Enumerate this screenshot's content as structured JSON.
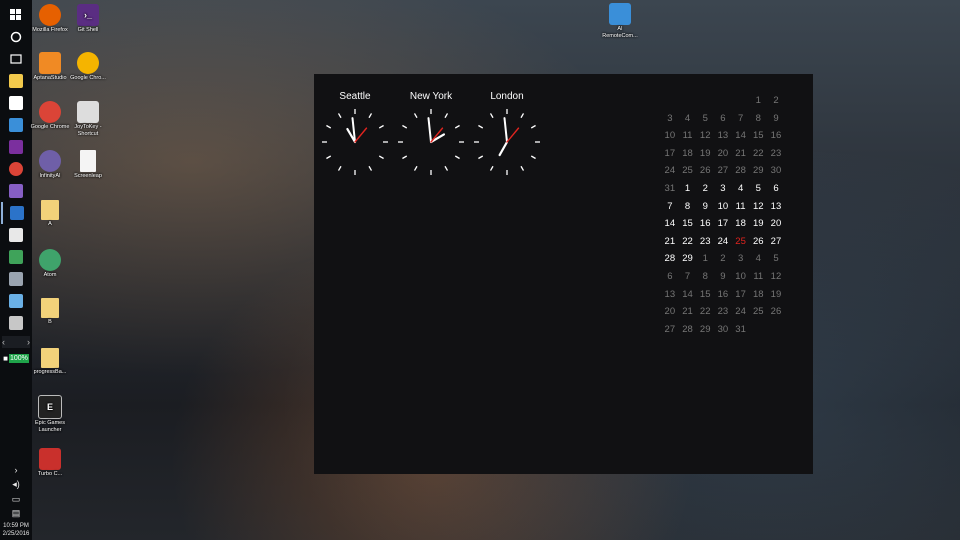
{
  "taskbar": {
    "battery_label": "100%",
    "time": "10:59 PM",
    "date": "2/25/2016"
  },
  "desktop_icons": [
    {
      "label": "Mozilla Firefox",
      "icon": "firefox-icon",
      "color": "#e66000"
    },
    {
      "label": "Git Shell",
      "icon": "git-shell-icon",
      "color": "#5a2d82"
    },
    {
      "label": "AptanaStudio",
      "icon": "aptana-icon",
      "color": "#f08a24"
    },
    {
      "label": "Google Chro...",
      "icon": "chrome-canary-icon",
      "color": "#f5b400"
    },
    {
      "label": "Google Chrome",
      "icon": "chrome-icon",
      "color": "#db4437"
    },
    {
      "label": "JoyToKey - Shortcut",
      "icon": "joytokey-icon",
      "color": "#dddddd"
    },
    {
      "label": "InfinityAI",
      "icon": "infinity-icon",
      "color": "#6f5fa8"
    },
    {
      "label": "Screenleap",
      "icon": "document-icon",
      "color": "#f4f4f4"
    },
    {
      "label": "A",
      "icon": "folder-icon",
      "color": "#f2d27a"
    },
    {
      "label": "Atom",
      "icon": "atom-icon",
      "color": "#3fa36b"
    },
    {
      "label": "B",
      "icon": "folder-icon",
      "color": "#f2d27a"
    },
    {
      "label": "progressBa...",
      "icon": "folder-icon",
      "color": "#f2d27a"
    },
    {
      "label": "Epic Games Launcher",
      "icon": "epic-games-icon",
      "color": "#222222"
    },
    {
      "label": "Turbo C...",
      "icon": "turbo-c-icon",
      "color": "#c9302c"
    },
    {
      "label": "AI RemoteCom...",
      "icon": "network-computer-icon",
      "color": "#3a8fd9"
    }
  ],
  "clocks": [
    {
      "city": "Seattle",
      "hour": 10,
      "minute": 59
    },
    {
      "city": "New York",
      "hour": 1,
      "minute": 59
    },
    {
      "city": "London",
      "hour": 6,
      "minute": 59
    }
  ],
  "calendar": {
    "rows": [
      [
        {
          "d": "",
          "c": 0
        },
        {
          "d": "",
          "c": 0
        },
        {
          "d": "",
          "c": 0
        },
        {
          "d": "",
          "c": 0
        },
        {
          "d": "",
          "c": 0
        },
        {
          "d": "1",
          "c": 0
        },
        {
          "d": "2",
          "c": 0
        }
      ],
      [
        {
          "d": "3",
          "c": 0
        },
        {
          "d": "4",
          "c": 0
        },
        {
          "d": "5",
          "c": 0
        },
        {
          "d": "6",
          "c": 0
        },
        {
          "d": "7",
          "c": 0
        },
        {
          "d": "8",
          "c": 0
        },
        {
          "d": "9",
          "c": 0
        }
      ],
      [
        {
          "d": "10",
          "c": 0
        },
        {
          "d": "11",
          "c": 0
        },
        {
          "d": "12",
          "c": 0
        },
        {
          "d": "13",
          "c": 0
        },
        {
          "d": "14",
          "c": 0
        },
        {
          "d": "15",
          "c": 0
        },
        {
          "d": "16",
          "c": 0
        }
      ],
      [
        {
          "d": "17",
          "c": 0
        },
        {
          "d": "18",
          "c": 0
        },
        {
          "d": "19",
          "c": 0
        },
        {
          "d": "20",
          "c": 0
        },
        {
          "d": "21",
          "c": 0
        },
        {
          "d": "22",
          "c": 0
        },
        {
          "d": "23",
          "c": 0
        }
      ],
      [
        {
          "d": "24",
          "c": 0
        },
        {
          "d": "25",
          "c": 0
        },
        {
          "d": "26",
          "c": 0
        },
        {
          "d": "27",
          "c": 0
        },
        {
          "d": "28",
          "c": 0
        },
        {
          "d": "29",
          "c": 0
        },
        {
          "d": "30",
          "c": 0
        }
      ],
      [
        {
          "d": "31",
          "c": 0
        },
        {
          "d": "1",
          "c": 1
        },
        {
          "d": "2",
          "c": 1
        },
        {
          "d": "3",
          "c": 1
        },
        {
          "d": "4",
          "c": 1
        },
        {
          "d": "5",
          "c": 1
        },
        {
          "d": "6",
          "c": 1
        }
      ],
      [
        {
          "d": "7",
          "c": 1
        },
        {
          "d": "8",
          "c": 1
        },
        {
          "d": "9",
          "c": 1
        },
        {
          "d": "10",
          "c": 1
        },
        {
          "d": "11",
          "c": 1
        },
        {
          "d": "12",
          "c": 1
        },
        {
          "d": "13",
          "c": 1
        }
      ],
      [
        {
          "d": "14",
          "c": 1
        },
        {
          "d": "15",
          "c": 1
        },
        {
          "d": "16",
          "c": 1
        },
        {
          "d": "17",
          "c": 1
        },
        {
          "d": "18",
          "c": 1
        },
        {
          "d": "19",
          "c": 1
        },
        {
          "d": "20",
          "c": 1
        }
      ],
      [
        {
          "d": "21",
          "c": 1
        },
        {
          "d": "22",
          "c": 1
        },
        {
          "d": "23",
          "c": 1
        },
        {
          "d": "24",
          "c": 1
        },
        {
          "d": "25",
          "c": 2
        },
        {
          "d": "26",
          "c": 1
        },
        {
          "d": "27",
          "c": 1
        }
      ],
      [
        {
          "d": "28",
          "c": 1
        },
        {
          "d": "29",
          "c": 1
        },
        {
          "d": "1",
          "c": 0
        },
        {
          "d": "2",
          "c": 0
        },
        {
          "d": "3",
          "c": 0
        },
        {
          "d": "4",
          "c": 0
        },
        {
          "d": "5",
          "c": 0
        }
      ],
      [
        {
          "d": "6",
          "c": 0
        },
        {
          "d": "7",
          "c": 0
        },
        {
          "d": "8",
          "c": 0
        },
        {
          "d": "9",
          "c": 0
        },
        {
          "d": "10",
          "c": 0
        },
        {
          "d": "11",
          "c": 0
        },
        {
          "d": "12",
          "c": 0
        }
      ],
      [
        {
          "d": "13",
          "c": 0
        },
        {
          "d": "14",
          "c": 0
        },
        {
          "d": "15",
          "c": 0
        },
        {
          "d": "16",
          "c": 0
        },
        {
          "d": "17",
          "c": 0
        },
        {
          "d": "18",
          "c": 0
        },
        {
          "d": "19",
          "c": 0
        }
      ],
      [
        {
          "d": "20",
          "c": 0
        },
        {
          "d": "21",
          "c": 0
        },
        {
          "d": "22",
          "c": 0
        },
        {
          "d": "23",
          "c": 0
        },
        {
          "d": "24",
          "c": 0
        },
        {
          "d": "25",
          "c": 0
        },
        {
          "d": "26",
          "c": 0
        }
      ],
      [
        {
          "d": "27",
          "c": 0
        },
        {
          "d": "28",
          "c": 0
        },
        {
          "d": "29",
          "c": 0
        },
        {
          "d": "30",
          "c": 0
        },
        {
          "d": "31",
          "c": 0
        },
        {
          "d": "",
          "c": 0
        },
        {
          "d": "",
          "c": 0
        }
      ]
    ]
  },
  "colors": {
    "widget_bg": "#111113",
    "second_hand": "#e0241f",
    "today": "#e0241f",
    "current_month_text": "#ffffff",
    "other_month_text": "#767676"
  }
}
